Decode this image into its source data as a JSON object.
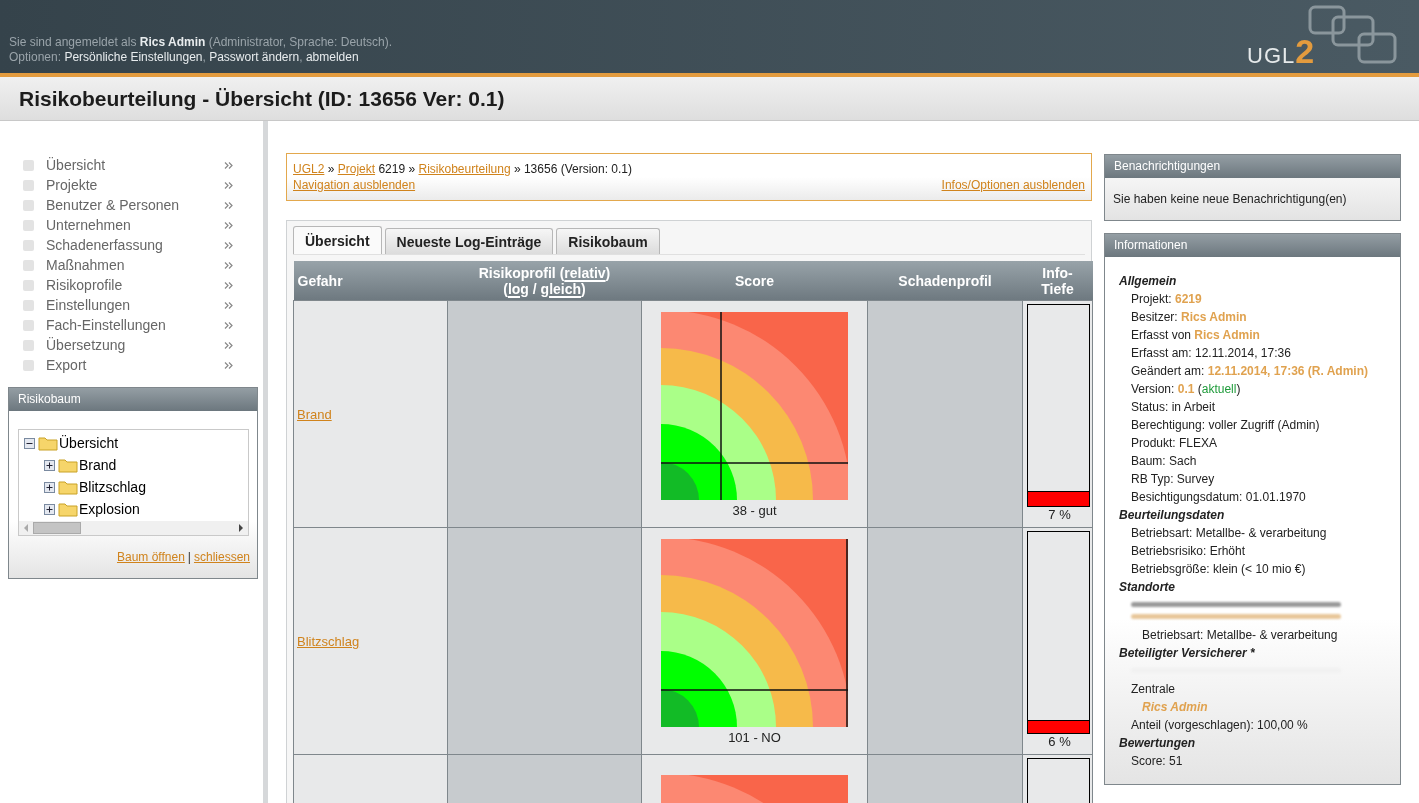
{
  "header": {
    "login": "Sie sind angemeldet als **Rics Admin** (Administrator, Sprache: Deutsch).",
    "options_label": "Optionen:",
    "options": [
      "Persönliche Einstellungen",
      "Passwort ändern",
      "abmelden"
    ],
    "options_separator": ",",
    "logo": {
      "text": "UGL",
      "digit": "2"
    }
  },
  "page_title": "Risikobeurteilung - Übersicht (ID: 13656 Ver: 0.1)",
  "sidebar": {
    "items": [
      "Übersicht",
      "Projekte",
      "Benutzer & Personen",
      "Unternehmen",
      "Schadenerfassung",
      "Maßnahmen",
      "Risikoprofile",
      "Einstellungen",
      "Fach-Einstellungen",
      "Übersetzung",
      "Export"
    ],
    "tree_panel": {
      "title": "Risikobaum",
      "tree": [
        {
          "label": "Übersicht",
          "expanded": true,
          "children": [
            {
              "label": "Brand",
              "expanded": false
            },
            {
              "label": "Blitzschlag",
              "expanded": false
            },
            {
              "label": "Explosion",
              "expanded": false
            }
          ]
        }
      ],
      "links": [
        "Baum öffnen",
        "schliessen"
      ],
      "links_separator": "|"
    }
  },
  "breadcrumb": [
    {
      "text": "UGL2",
      "link": true
    },
    {
      "text": "»",
      "link": false
    },
    {
      "text": "Projekt",
      "link": true
    },
    {
      "text": "6219",
      "link": false
    },
    {
      "text": "»",
      "link": false
    },
    {
      "text": "Risikobeurteilung",
      "link": true
    },
    {
      "text": "» 13656 (Version: 0.1)",
      "link": false
    }
  ],
  "nav_links": [
    "Navigation ausblenden",
    "Infos/Optionen ausblenden"
  ],
  "tabs": [
    {
      "label": "Übersicht",
      "selected": true
    },
    {
      "label": "Neueste Log-Einträge",
      "selected": false
    },
    {
      "label": "Risikobaum",
      "selected": false
    }
  ],
  "table": {
    "columns": [
      {
        "parts": [
          {
            "text": "Gefahr",
            "link": false
          }
        ]
      },
      {
        "parts": [
          {
            "text": "Risikoprofil (",
            "link": false
          },
          {
            "text": "relativ",
            "link": true
          },
          {
            "text": ")",
            "link": false
          },
          {
            "text": "(",
            "link": false,
            "br": true
          },
          {
            "text": "log",
            "link": true
          },
          {
            "text": " / ",
            "link": false
          },
          {
            "text": "gleich",
            "link": true
          },
          {
            "text": ")",
            "link": false
          }
        ]
      },
      {
        "parts": [
          {
            "text": "Score",
            "link": false
          }
        ]
      },
      {
        "parts": [
          {
            "text": "Schadenprofil",
            "link": false
          }
        ]
      },
      {
        "parts": [
          {
            "text": "Info-Tiefe",
            "link": false
          }
        ]
      }
    ],
    "rows": [
      {
        "hazard": "Brand",
        "kind": "crosshair",
        "score": "38 - gut",
        "level": 0.07,
        "reading": "7 %"
      },
      {
        "hazard": "Blitzschlag",
        "kind": "baseline",
        "score": "101 - NO",
        "level": 0.06,
        "reading": "6 %"
      },
      {
        "kind": "plain"
      }
    ]
  },
  "notifications": {
    "title": "Benachrichtigungen",
    "text": "Sie haben keine neue Benachrichtigung(en)"
  },
  "info": {
    "title": "Informationen",
    "lines": [
      {
        "kind": "heading",
        "parts": [
          {
            "t": "Allgemein",
            "kind": "plain"
          }
        ]
      },
      {
        "kind": "line",
        "parts": [
          {
            "t": "Projekt: ",
            "kind": "plain"
          },
          {
            "t": "6219",
            "kind": "value"
          }
        ]
      },
      {
        "kind": "line",
        "parts": [
          {
            "t": "Besitzer: ",
            "kind": "plain"
          },
          {
            "t": "Rics Admin",
            "kind": "value"
          }
        ]
      },
      {
        "kind": "line",
        "parts": [
          {
            "t": "Erfasst von ",
            "kind": "plain"
          },
          {
            "t": "Rics Admin",
            "kind": "value"
          }
        ]
      },
      {
        "kind": "line",
        "parts": [
          {
            "t": "Erfasst am: 12.11.2014, 17:36",
            "kind": "plain"
          }
        ]
      },
      {
        "kind": "line",
        "parts": [
          {
            "t": "Geändert am: ",
            "kind": "plain"
          },
          {
            "t": "12.11.2014, 17:36 (R. Admin)",
            "kind": "value"
          }
        ]
      },
      {
        "kind": "line",
        "parts": [
          {
            "t": "Version: ",
            "kind": "plain"
          },
          {
            "t": "0.1",
            "kind": "value"
          },
          {
            "t": " (",
            "kind": "plain"
          },
          {
            "t": "aktuell",
            "kind": "ok"
          },
          {
            "t": ")",
            "kind": "plain"
          }
        ]
      },
      {
        "kind": "line",
        "parts": [
          {
            "t": "Status: in Arbeit",
            "kind": "plain"
          }
        ]
      },
      {
        "kind": "line",
        "parts": [
          {
            "t": "Berechtigung: voller Zugriff (Admin)",
            "kind": "plain"
          }
        ]
      },
      {
        "kind": "line",
        "parts": [
          {
            "t": "Produkt: FLEXA",
            "kind": "plain"
          }
        ]
      },
      {
        "kind": "line",
        "parts": [
          {
            "t": "Baum: Sach",
            "kind": "plain"
          }
        ]
      },
      {
        "kind": "line",
        "parts": [
          {
            "t": "RB Typ: Survey",
            "kind": "plain"
          }
        ]
      },
      {
        "kind": "line",
        "parts": [
          {
            "t": "Besichtigungsdatum: 01.01.1970",
            "kind": "plain"
          }
        ]
      },
      {
        "kind": "heading",
        "parts": [
          {
            "t": "Beurteilungsdaten",
            "kind": "plain"
          }
        ]
      },
      {
        "kind": "line",
        "parts": [
          {
            "t": "Betriebsart: Metallbe- & verarbeitung",
            "kind": "plain"
          }
        ]
      },
      {
        "kind": "line",
        "parts": [
          {
            "t": "Betriebsrisiko: Erhöht",
            "kind": "plain"
          }
        ]
      },
      {
        "kind": "line",
        "parts": [
          {
            "t": "Betriebsgröße: klein (< 10 mio €)",
            "kind": "plain"
          }
        ]
      },
      {
        "kind": "heading",
        "parts": [
          {
            "t": "Standorte",
            "kind": "plain"
          }
        ]
      },
      {
        "kind": "redacted",
        "color": "#9a9a9a"
      },
      {
        "kind": "redacted",
        "color": "#e8c79a"
      },
      {
        "kind": "sub",
        "parts": [
          {
            "t": "Betriebsart: Metallbe- & verarbeitung",
            "kind": "plain"
          }
        ]
      },
      {
        "kind": "heading",
        "parts": [
          {
            "t": "Beteiligter Versicherer *",
            "kind": "plain"
          }
        ]
      },
      {
        "kind": "redacted",
        "color": "#f1f1f1"
      },
      {
        "kind": "line",
        "parts": [
          {
            "t": "Zentrale",
            "kind": "plain"
          }
        ]
      },
      {
        "kind": "sub",
        "parts": [
          {
            "t": "Rics Admin",
            "kind": "person"
          }
        ]
      },
      {
        "kind": "line",
        "parts": [
          {
            "t": "Anteil (vorgeschlagen): 100,00 %",
            "kind": "plain"
          }
        ]
      },
      {
        "kind": "heading",
        "parts": [
          {
            "t": "Bewertungen",
            "kind": "plain"
          }
        ]
      },
      {
        "kind": "line",
        "parts": [
          {
            "t": "Score: 51",
            "kind": "plain"
          }
        ]
      }
    ]
  }
}
